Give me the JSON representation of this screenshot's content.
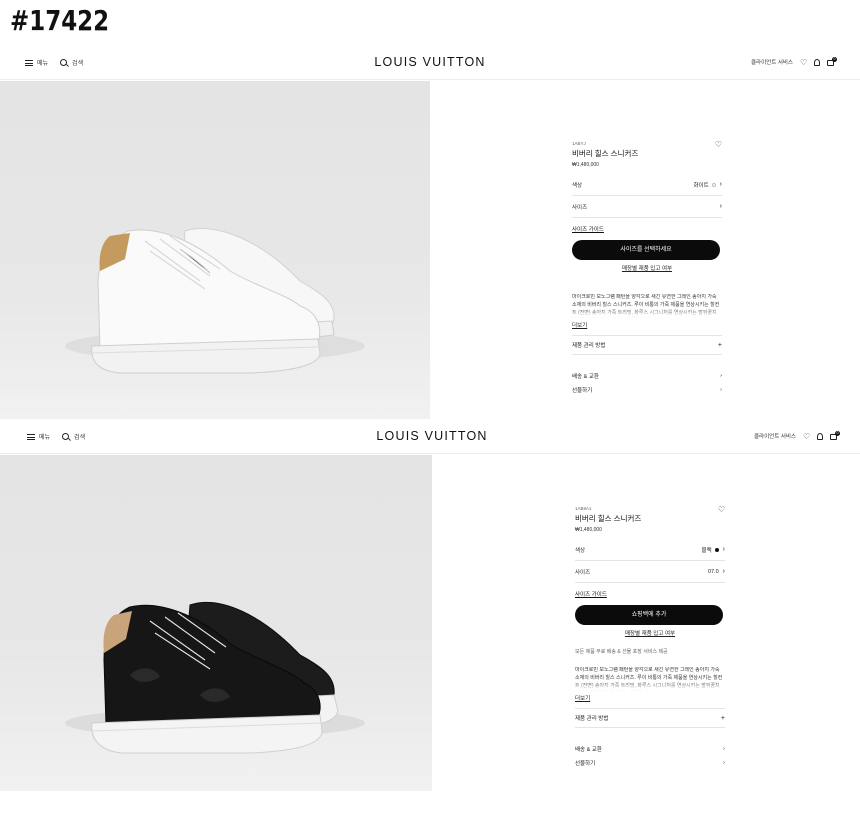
{
  "badge": "#17422",
  "colors": {
    "accent": "#0b0b0b",
    "hero_bg": "#e6e6e6",
    "divider": "#e5e5e5"
  },
  "panels": [
    {
      "header": {
        "menu_label": "메뉴",
        "search_label": "검색",
        "logo": "LOUIS VUITTON",
        "client_service": "클라이언트 서비스",
        "bag_count": "0"
      },
      "product": {
        "sku": "1ABYJ",
        "title": "비버리 힐스 스니커즈",
        "price": "₩1,480,000",
        "color_label": "색상",
        "color_value": "화이트",
        "size_label": "사이즈",
        "size_value": "",
        "size_guide": "사이즈 가이드",
        "cta": "사이즈를 선택하세요",
        "store_stock": "매장별 재품 입고 여부",
        "note": "",
        "description": "마이크로빈 모노그램 패턴을 양각으로 새긴 유연한 그레인 송아지 가죽 소재의 비버리 힐스 스니커즈. 루이 비통의 가죽 제품을 연상시키는 힐컨트 (전면) 송아지 가죽 트리밍, 화루스 시그니처를 연상시키는 발뒤꿈치 레이스 트리밍이 돋보이는 제품입니다.",
        "more": "더보기",
        "care": "제품 관리 방법",
        "shipping": "배송 & 교환",
        "gift": "선물하기"
      },
      "icons": [
        "menu-icon",
        "search-icon",
        "heart-icon",
        "user-icon",
        "bag-icon",
        "chevron-right-icon",
        "plus-icon"
      ]
    },
    {
      "header": {
        "menu_label": "메뉴",
        "search_label": "검색",
        "logo": "LOUIS VUITTON",
        "client_service": "클라이언트 서비스",
        "bag_count": "0"
      },
      "product": {
        "sku": "1AB9A1",
        "title": "비버리 힐스 스니커즈",
        "price": "₩1,480,000",
        "color_label": "색상",
        "color_value": "블랙",
        "size_label": "사이즈",
        "size_value": "07.0",
        "size_guide": "사이즈 가이드",
        "cta": "쇼핑백에 추가",
        "store_stock": "매장별 재품 입고 여부",
        "note": "모든 제품 무료 배송 & 선물 포장 서비스 제공",
        "description": "마이크로빈 모노그램 패턴을 양각으로 새긴 유연한 그레인 송아지 가죽 소재의 비버리 힐스 스니커즈. 루이 비통의 가죽 제품을 연상시키는 힐컨트 (전면) 송아지 가죽 트리밍, 화루스 시그니처를 연상시키는 발뒤꿈치 레이스 트리밍이 돋보이는 제품입니다.",
        "more": "더보기",
        "care": "제품 관리 방법",
        "shipping": "배송 & 교환",
        "gift": "선물하기"
      }
    }
  ]
}
